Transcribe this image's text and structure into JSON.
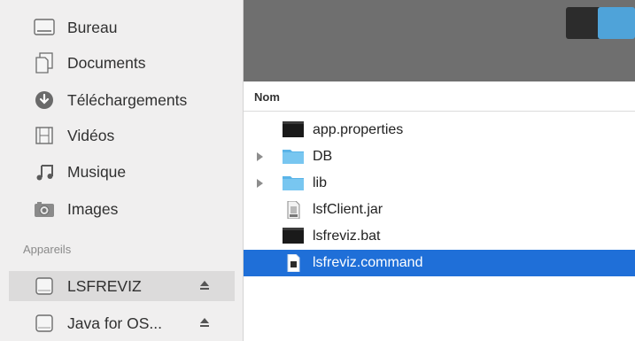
{
  "sidebar": {
    "favorites": [
      {
        "label": "Bureau",
        "icon": "desktop-icon"
      },
      {
        "label": "Documents",
        "icon": "documents-icon"
      },
      {
        "label": "Téléchargements",
        "icon": "download-icon"
      },
      {
        "label": "Vidéos",
        "icon": "movies-icon"
      },
      {
        "label": "Musique",
        "icon": "music-icon"
      },
      {
        "label": "Images",
        "icon": "camera-icon"
      }
    ],
    "devices_heading": "Appareils",
    "devices": [
      {
        "label": "LSFREVIZ",
        "icon": "disk-icon",
        "selected": true,
        "eject": true
      },
      {
        "label": "Java for OS...",
        "icon": "disk-icon",
        "selected": false,
        "eject": true
      }
    ]
  },
  "main": {
    "column_header": "Nom",
    "files": [
      {
        "name": "app.properties",
        "icon": "terminal-file-icon",
        "folder": false,
        "selected": false
      },
      {
        "name": "DB",
        "icon": "folder-icon",
        "folder": true,
        "selected": false
      },
      {
        "name": "lib",
        "icon": "folder-icon",
        "folder": true,
        "selected": false
      },
      {
        "name": "lsfClient.jar",
        "icon": "jar-file-icon",
        "folder": false,
        "selected": false
      },
      {
        "name": "lsfreviz.bat",
        "icon": "terminal-file-icon",
        "folder": false,
        "selected": false
      },
      {
        "name": "lsfreviz.command",
        "icon": "command-file-icon",
        "folder": false,
        "selected": true
      }
    ]
  },
  "colors": {
    "selection": "#1f6fd8",
    "sidebar_bg": "#f0efef",
    "preview_bg": "#6f6f6f"
  }
}
